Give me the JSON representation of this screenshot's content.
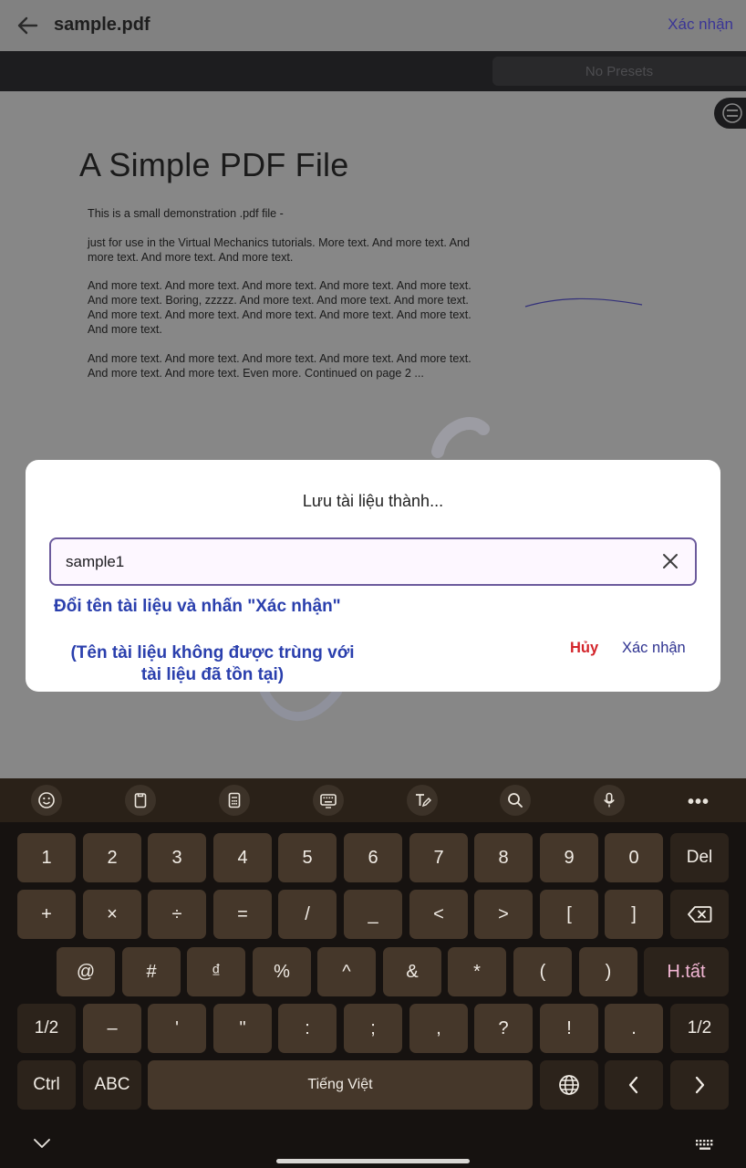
{
  "appbar": {
    "title": "sample.pdf",
    "confirm_label": "Xác nhận"
  },
  "toolbar": {
    "presets_label": "No Presets"
  },
  "document": {
    "title": "A Simple PDF File",
    "paragraphs": [
      "This is a small demonstration .pdf file -",
      "just for use in the Virtual Mechanics tutorials. More text. And more text. And more text. And more text. And more text.",
      "And more text. And more text. And more text. And more text. And more text. And more text. Boring, zzzzz. And more text. And more text. And more text. And more text. And more text. And more text. And more text. And more text. And more text.",
      "And more text. And more text. And more text. And more text. And more text. And more text. And more text. Even more. Continued on page 2 ..."
    ]
  },
  "dialog": {
    "title": "Lưu tài liệu thành...",
    "filename_value": "sample1",
    "hint_rename": "Đổi tên tài liệu và nhấn \"Xác nhận\"",
    "hint_unique_line1": "(Tên tài liệu không được trùng với",
    "hint_unique_line2": "tài liệu đã tồn tại)",
    "cancel_label": "Hủy",
    "confirm_label": "Xác nhận"
  },
  "keyboard": {
    "toolbar_icons": [
      "emoji-icon",
      "clipboard-icon",
      "calculator-icon",
      "keyboard-layout-icon",
      "handwriting-icon",
      "search-icon",
      "microphone-icon",
      "more-icon"
    ],
    "more_label": "•••",
    "rows": [
      [
        "1",
        "2",
        "3",
        "4",
        "5",
        "6",
        "7",
        "8",
        "9",
        "0",
        "Del"
      ],
      [
        "+",
        "×",
        "÷",
        "=",
        "/",
        "_",
        "<",
        ">",
        "[",
        "]",
        "backspace"
      ],
      [
        "@",
        "#",
        "₫",
        "%",
        "^",
        "&",
        "*",
        "(",
        ")",
        "H.tất"
      ],
      [
        "1/2",
        "–",
        "'",
        "\"",
        ":",
        ";",
        ",",
        "?",
        "!",
        ".",
        "1/2"
      ],
      [
        "Ctrl",
        "ABC",
        "Tiếng Việt",
        "globe",
        "left-arrow",
        "right-arrow"
      ]
    ]
  },
  "colors": {
    "accent": "#3a3596",
    "hint_blue": "#2a3fad",
    "cancel_red": "#d3242a",
    "key_bg": "#45372a",
    "keyboard_bg": "#161210"
  }
}
